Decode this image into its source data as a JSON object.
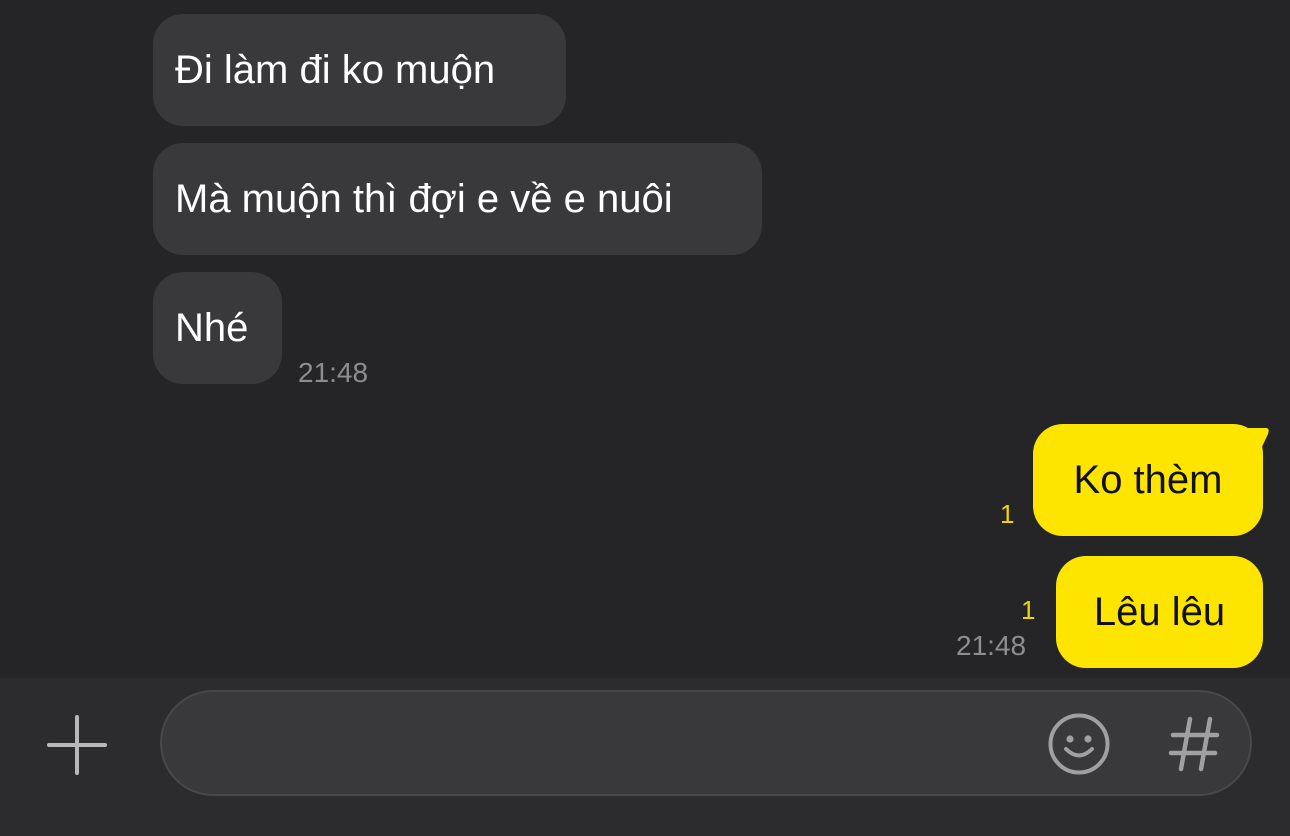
{
  "chat": {
    "incoming": [
      {
        "text": "Đi làm đi ko muộn"
      },
      {
        "text": "Mà muộn thì đợi e về e nuôi"
      },
      {
        "text": "Nhé"
      }
    ],
    "incoming_time": "21:48",
    "outgoing": [
      {
        "text": "Ko thèm",
        "unread": "1"
      },
      {
        "text": "Lêu lêu",
        "unread": "1"
      }
    ],
    "outgoing_time": "21:48"
  },
  "composer": {
    "placeholder": "",
    "icons": {
      "add": "plus-icon",
      "emoji": "smiley-icon",
      "hashtag": "hashtag-icon"
    }
  },
  "colors": {
    "background": "#252527",
    "incoming_bubble": "#39393b",
    "outgoing_bubble": "#fee500",
    "unread_count": "#f2d500",
    "timestamp": "#8e8e90"
  }
}
